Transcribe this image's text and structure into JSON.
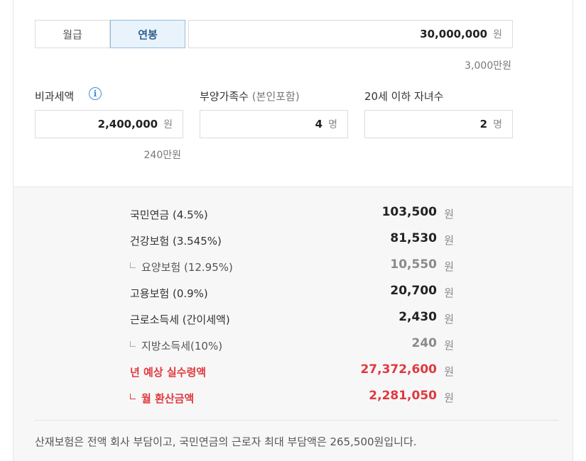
{
  "tabs": [
    {
      "label": "월급",
      "active": false
    },
    {
      "label": "연봉",
      "active": true
    }
  ],
  "salary": {
    "value": "30,000,000",
    "unit": "원",
    "sub": "3,000만원"
  },
  "nontax": {
    "label": "비과세액",
    "value": "2,400,000",
    "unit": "원",
    "sub": "240만원",
    "icon": "info-icon"
  },
  "dependents": {
    "label": "부양가족수",
    "label_paren": "(본인포함)",
    "value": "4",
    "unit": "명"
  },
  "children": {
    "label": "20세 이하 자녀수",
    "value": "2",
    "unit": "명"
  },
  "results": [
    {
      "name": "국민연금 (4.5%)",
      "amount": "103,500",
      "unit": "원",
      "style": "normal"
    },
    {
      "name": "건강보험 (3.545%)",
      "amount": "81,530",
      "unit": "원",
      "style": "normal"
    },
    {
      "name": "요양보험 (12.95%)",
      "amount": "10,550",
      "unit": "원",
      "style": "gray"
    },
    {
      "name": "고용보험 (0.9%)",
      "amount": "20,700",
      "unit": "원",
      "style": "normal"
    },
    {
      "name": "근로소득세 (간이세액)",
      "amount": "2,430",
      "unit": "원",
      "style": "normal"
    },
    {
      "name": "지방소득세(10%)",
      "amount": "240",
      "unit": "원",
      "style": "gray"
    },
    {
      "name": "년 예상 실수령액",
      "amount": "27,372,600",
      "unit": "원",
      "style": "red"
    },
    {
      "name": "월 환산금액",
      "amount": "2,281,050",
      "unit": "원",
      "style": "red-sub"
    }
  ],
  "note": "산재보험은 전액 회사 부담이고, 국민연금의 근로자 최대 부담액은 265,500원입니다.",
  "colors": {
    "accent": "#3d8fd6",
    "highlight": "#e0393e",
    "active_tab_bg": "#e9f3fb"
  }
}
